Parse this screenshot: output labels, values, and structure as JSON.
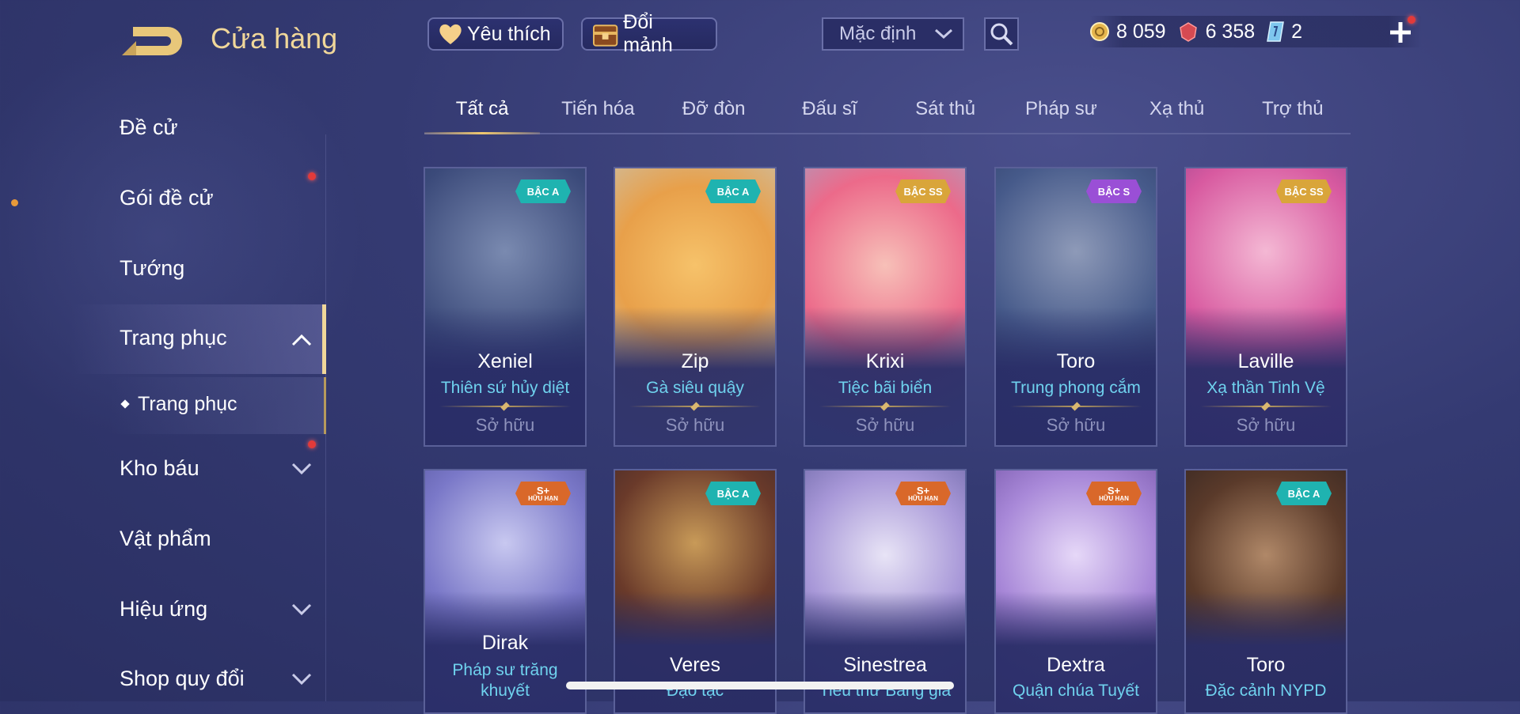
{
  "header": {
    "title": "Cửa hàng",
    "favorites_label": "Yêu thích",
    "exchange_label": "Đổi mảnh",
    "sort_value": "Mặc định",
    "currencies": [
      {
        "icon": "gold-coin-icon",
        "value": "8 059"
      },
      {
        "icon": "red-gem-icon",
        "value": "6 358"
      },
      {
        "icon": "card-voucher-icon",
        "value": "2"
      }
    ]
  },
  "tabs": [
    "Tất cả",
    "Tiến hóa",
    "Đỡ đòn",
    "Đấu sĩ",
    "Sát thủ",
    "Pháp sư",
    "Xạ thủ",
    "Trợ thủ"
  ],
  "sidebar": {
    "items": [
      "Đề cử",
      "Gói đề cử",
      "Tướng",
      "Trang phục",
      "Kho báu",
      "Vật phẩm",
      "Hiệu ứng",
      "Shop quy đổi"
    ],
    "sub_item": "Trang phục",
    "active": "Trang phục"
  },
  "skins": [
    {
      "hero": "Xeniel",
      "skin": "Thiên sứ hủy diệt",
      "status": "Sở hữu",
      "grade": "BẬC A",
      "grade_color": "#1fb3b0"
    },
    {
      "hero": "Zip",
      "skin": "Gà siêu quậy",
      "status": "Sở hữu",
      "grade": "BẬC A",
      "grade_color": "#1fb3b0"
    },
    {
      "hero": "Krixi",
      "skin": "Tiệc bãi biển",
      "status": "Sở hữu",
      "grade": "BẬC SS",
      "grade_color": "#d9a53a"
    },
    {
      "hero": "Toro",
      "skin": "Trung phong cắm",
      "status": "Sở hữu",
      "grade": "BẬC S",
      "grade_color": "#9a4fd6"
    },
    {
      "hero": "Laville",
      "skin": "Xạ thần Tinh Vệ",
      "status": "Sở hữu",
      "grade": "BẬC SS",
      "grade_color": "#d9a53a"
    },
    {
      "hero": "Dirak",
      "skin": "Pháp sư trăng khuyết",
      "grade": "S+",
      "grade_sub": "HỮU HẠN",
      "grade_color": "#d9682a"
    },
    {
      "hero": "Veres",
      "skin": "Đạo tặc",
      "grade": "BẬC A",
      "grade_color": "#1fb3b0"
    },
    {
      "hero": "Sinestrea",
      "skin": "Tiểu thư Băng giá",
      "grade": "S+",
      "grade_sub": "HỮU HẠN",
      "grade_color": "#d9682a"
    },
    {
      "hero": "Dextra",
      "skin": "Quận chúa Tuyết",
      "grade": "S+",
      "grade_sub": "HỮU HẠN",
      "grade_color": "#d9682a"
    },
    {
      "hero": "Toro",
      "skin": "Đặc cảnh NYPD",
      "grade": "BẬC A",
      "grade_color": "#1fb3b0"
    }
  ]
}
